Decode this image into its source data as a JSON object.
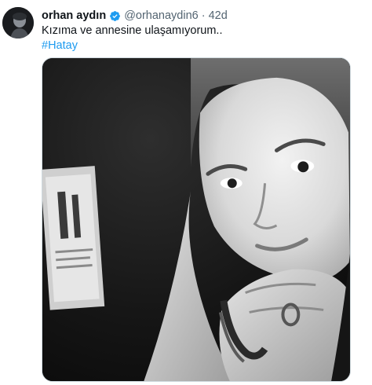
{
  "tweet": {
    "display_name": "orhan aydın",
    "handle": "@orhanaydin6",
    "separator": "·",
    "time": "42d",
    "text_line1": "Kızıma ve annesine ulaşamıyorum..",
    "hashtag": "#Hatay",
    "verified": true
  },
  "icons": {
    "verified": "verified-badge-icon"
  },
  "colors": {
    "link": "#1d9bf0",
    "secondary_text": "#536471",
    "primary_text": "#0f1419",
    "verified": "#1d9bf0"
  }
}
